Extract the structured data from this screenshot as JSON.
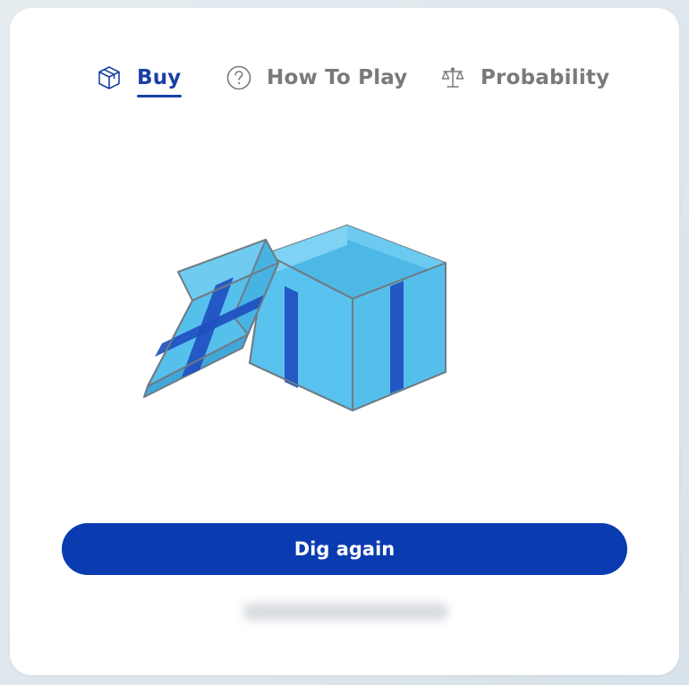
{
  "tabs": [
    {
      "label": "Buy",
      "icon": "box-icon",
      "active": true
    },
    {
      "label": "How To Play",
      "icon": "question-circle-icon",
      "active": false
    },
    {
      "label": "Probability",
      "icon": "scale-icon",
      "active": false
    }
  ],
  "main": {
    "illustration": "open-gift-box-icon",
    "action_label": "Dig again"
  },
  "colors": {
    "accent": "#0b3bb0",
    "active_tab": "#1a3fa6",
    "inactive_tab": "#7a7a7a",
    "box_light": "#5ec6ee",
    "box_ribbon": "#1f4fc0"
  }
}
